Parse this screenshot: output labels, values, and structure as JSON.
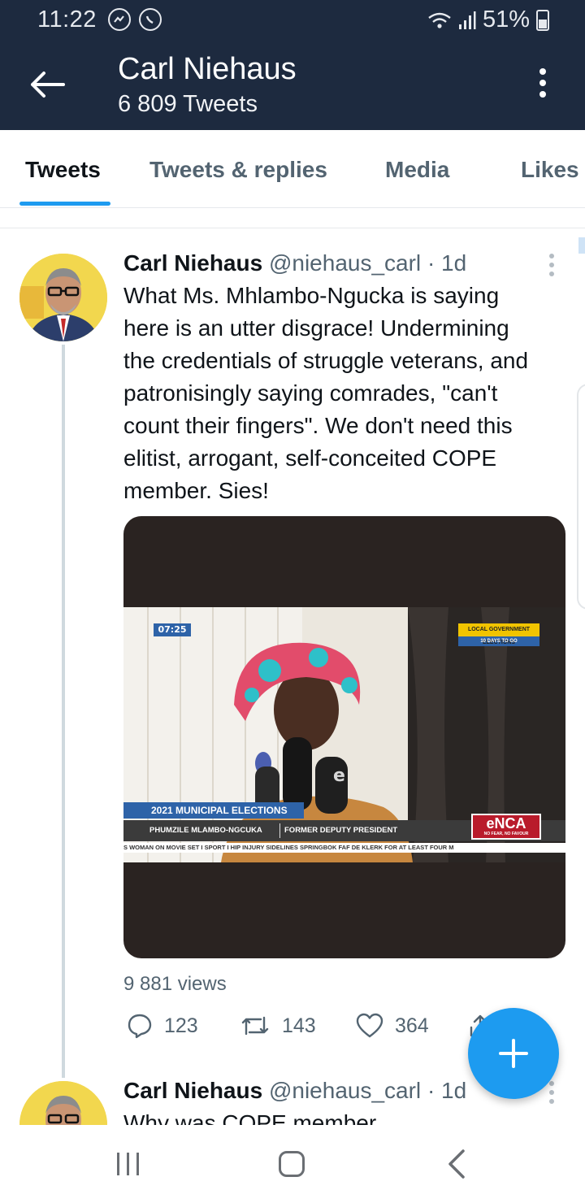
{
  "status_bar": {
    "time": "11:22",
    "battery": "51%",
    "notification_icons": [
      "messenger-icon",
      "whatsapp-icon"
    ]
  },
  "header": {
    "title": "Carl Niehaus",
    "subtitle": "6 809 Tweets"
  },
  "tabs": [
    {
      "label": "Tweets",
      "active": true
    },
    {
      "label": "Tweets & replies",
      "active": false
    },
    {
      "label": "Media",
      "active": false
    },
    {
      "label": "Likes",
      "active": false
    }
  ],
  "tweets": [
    {
      "name": "Carl Niehaus",
      "handle": "@niehaus_carl",
      "time": "· 1d",
      "text_lines": [
        "What Ms. Mhlambo-Ngucka is saying",
        "here is an utter disgrace! Undermining",
        "the credentials of struggle veterans, and",
        "patronisingly saying comrades, \"can't",
        "count their fingers\". We don't need this",
        "elitist, arrogant, self-conceited COPE",
        "member. Sies!"
      ],
      "video": {
        "clock": "07:25",
        "badge_top": "LOCAL GOVERNMENT ELECTIONS",
        "badge_bottom": "10 DAYS TO GO",
        "lower_third": "2021 MUNICIPAL ELECTIONS",
        "speaker_name": "PHUMZILE MLAMBO-NGCUKA",
        "speaker_title": "FORMER DEPUTY PRESIDENT",
        "channel": "eNCA",
        "channel_tag": "NO FEAR, NO FAVOUR",
        "ticker": "S WOMAN ON MOVIE SET  I  SPORT  I  HIP INJURY SIDELINES SPRINGBOK FAF DE KLERK FOR AT LEAST FOUR M"
      },
      "views": "9 881 views",
      "replies": "123",
      "retweets": "143",
      "likes": "364"
    },
    {
      "name": "Carl Niehaus",
      "handle": "@niehaus_carl",
      "time": "· 1d",
      "text_partial": "Why was COPE member"
    }
  ],
  "colors": {
    "header_bg": "#1d2a3f",
    "accent": "#1d9bf0",
    "muted": "#536471"
  }
}
